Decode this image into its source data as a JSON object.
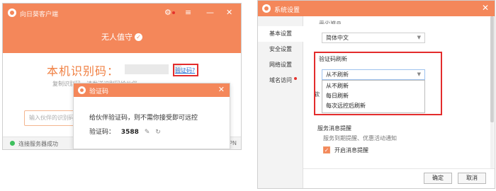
{
  "left": {
    "app_title": "向日葵客户端",
    "unattended": "无人值守",
    "id_label": "本机识别码：",
    "vcode_link": "验证码?",
    "hint": "复制识别码，请发送识别码给伙伴",
    "partner_placeholder": "输入伙伴的识别码",
    "status": "连接服务器成功",
    "vpn": "PN"
  },
  "popup": {
    "title": "验证码",
    "message": "给伙伴验证码，则不需你接受即可远控",
    "code_label": "验证码：",
    "code": "3588"
  },
  "right": {
    "title": "系统设置",
    "sidebar": [
      {
        "label": "基本设置"
      },
      {
        "label": "安全设置"
      },
      {
        "label": "网络设置"
      },
      {
        "label": "域名访问"
      }
    ],
    "display_lang_label": "显示语言",
    "lang_value": "简体中文",
    "refresh_label": "验证码刷新",
    "refresh_value": "从不刷新",
    "refresh_options": [
      {
        "label": "从不刷新"
      },
      {
        "label": "每日刷新"
      },
      {
        "label": "每次远控后刷新"
      }
    ],
    "under_label": "软",
    "svc_label": "服务消息提醒",
    "svc_desc": "服务到期提醒、优惠活动通知",
    "svc_check_label": "开启消息提醒",
    "ok": "确定",
    "cancel": "取消"
  },
  "colors": {
    "accent": "#f4875a",
    "highlight_border": "#e32c2c",
    "link": "#2a72d4",
    "online": "#3ec05e"
  }
}
